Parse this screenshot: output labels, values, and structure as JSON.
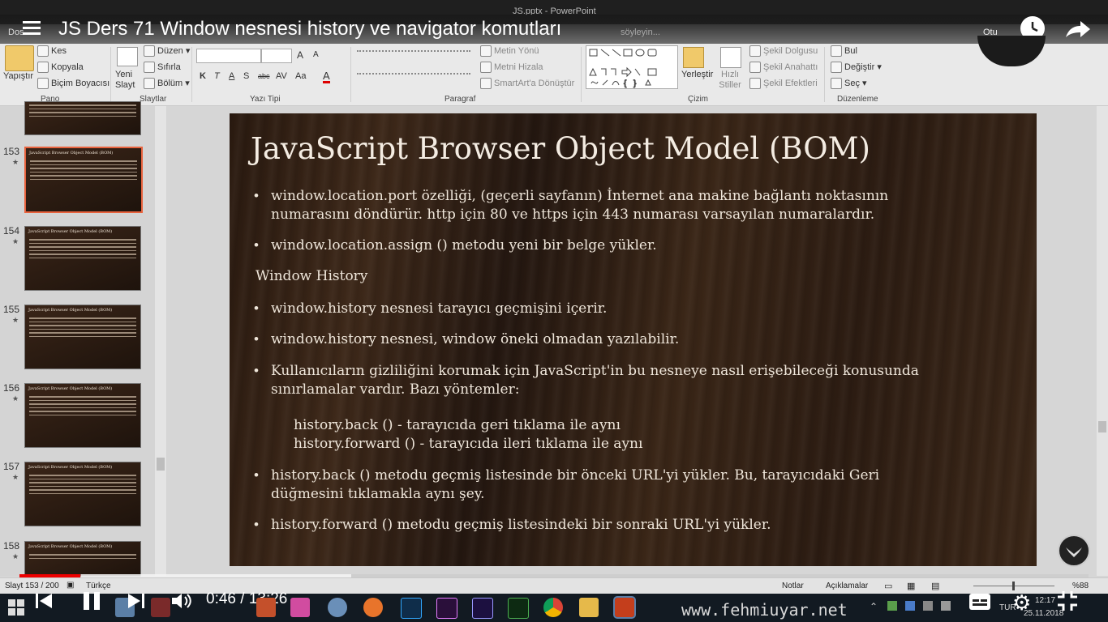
{
  "window": {
    "title": "JS.pptx - PowerPoint",
    "tabs_left": "Dos",
    "tell_me": "söyleyin...",
    "user": "Otu"
  },
  "video": {
    "title": "JS Ders 71 Window nesnesi history ve navigator komutları",
    "time_current": "0:46",
    "time_total": "13:26",
    "time_separator": "/",
    "progress": 0.057
  },
  "ribbon": {
    "pano": {
      "label": "Pano",
      "paste": "Yapıştır",
      "cut": "Kes",
      "copy": "Kopyala",
      "format_painter": "Biçim Boyacısı"
    },
    "slaytlar": {
      "label": "Slaytlar",
      "new_slide": "Yeni Slayt",
      "layout": "Düzen",
      "reset": "Sıfırla",
      "section": "Bölüm"
    },
    "yazi_tipi": {
      "label": "Yazı Tipi",
      "bold": "K",
      "italic": "T",
      "underline": "A",
      "strike": "S",
      "abc": "abc",
      "av": "AV",
      "aa": "Aa",
      "font_color": "A",
      "grow": "A",
      "shrink": "A"
    },
    "paragraf": {
      "label": "Paragraf",
      "text_direction": "Metin Yönü",
      "align_text": "Metni Hizala",
      "smartart": "SmartArt'a Dönüştür"
    },
    "cizim": {
      "label": "Çizim",
      "arrange": "Yerleştir",
      "quick_styles": "Hızlı Stiller",
      "shape_fill": "Şekil Dolgusu",
      "shape_outline": "Şekil Anahattı",
      "shape_effects": "Şekil Efektleri"
    },
    "duzenleme": {
      "label": "Düzenleme",
      "find": "Bul",
      "replace": "Değiştir",
      "select": "Seç"
    }
  },
  "thumbnails": [
    {
      "num": "153",
      "title": "JavaScript Browser Object Model (BOM)",
      "selected": true
    },
    {
      "num": "154",
      "title": "JavaScript Browser Object Model (BOM)",
      "selected": false
    },
    {
      "num": "155",
      "title": "JavaScript Browser Object Model (BOM)",
      "selected": false
    },
    {
      "num": "156",
      "title": "JavaScript Browser Object Model (BOM)",
      "selected": false
    },
    {
      "num": "157",
      "title": "JavaScript Browser Object Model (BOM)",
      "selected": false
    },
    {
      "num": "158",
      "title": "JavaScript Browser Object Model (BOM)",
      "selected": false
    }
  ],
  "slide": {
    "title": "JavaScript Browser Object Model (BOM)",
    "b1a": "window.location.port özelliği, (geçerli sayfanın) İnternet ana makine bağlantı noktasının",
    "b1b": "numarasını döndürür. http için 80  ve https için 443  numarası varsayılan numaralardır.",
    "b2": "window.location.assign () metodu yeni bir belge yükler.",
    "heading": "Window History",
    "b3": "window.history nesnesi tarayıcı geçmişini içerir.",
    "b4": "window.history nesnesi, window öneki olmadan yazılabilir.",
    "b5a": "Kullanıcıların gizliliğini korumak için JavaScript'in bu nesneye nasıl erişebileceği konusunda",
    "b5b": "sınırlamalar vardır. Bazı yöntemler:",
    "sub1": "history.back () - tarayıcıda geri tıklama ile aynı",
    "sub2": "history.forward () - tarayıcıda ileri tıklama ile aynı",
    "b6a": "history.back () metodu geçmiş listesinde bir önceki URL'yi yükler. Bu, tarayıcıdaki Geri",
    "b6b": "düğmesini tıklamakla aynı şey.",
    "b7": "history.forward () metodu geçmiş listesindeki bir sonraki URL'yi yükler."
  },
  "status": {
    "slide": "Slayt 153 / 200",
    "language": "Türkçe",
    "notes": "Notlar",
    "comments": "Açıklamalar",
    "zoom": "%88"
  },
  "taskbar": {
    "site": "www.fehmiuyar.net",
    "lang": "TUR",
    "time": "12:17",
    "date": "25.11.2018"
  },
  "colors": {
    "accent": "#e8623d",
    "progress": "#ee0000",
    "slide_text": "#efe6da"
  }
}
